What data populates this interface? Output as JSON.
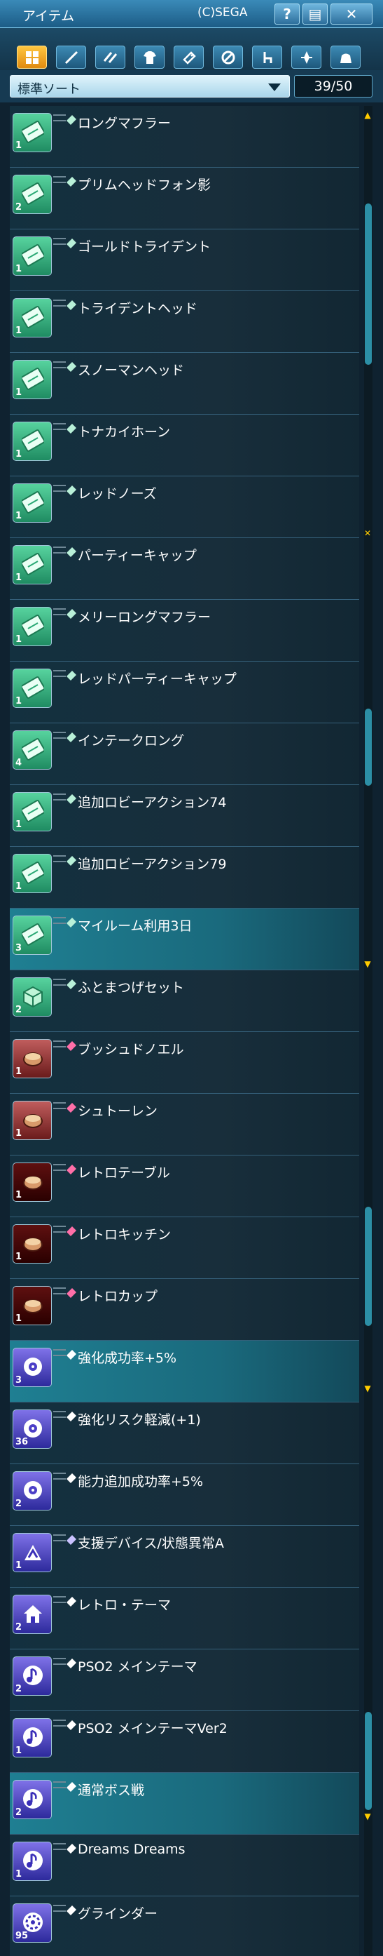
{
  "window": {
    "title": "アイテム",
    "copyright": "(C)SEGA"
  },
  "title_buttons": [
    {
      "name": "help-button",
      "label": "?"
    },
    {
      "name": "layout-button",
      "label": "▤"
    },
    {
      "name": "close-button",
      "label": "✕"
    }
  ],
  "categories": [
    {
      "name": "all-category-tab",
      "active": true
    },
    {
      "name": "weapon-category-tab"
    },
    {
      "name": "double-weapon-category-tab"
    },
    {
      "name": "armor-category-tab"
    },
    {
      "name": "accessory-category-tab"
    },
    {
      "name": "unit-category-tab"
    },
    {
      "name": "furniture-category-tab"
    },
    {
      "name": "compass-category-tab"
    },
    {
      "name": "bag-category-tab"
    }
  ],
  "sort": {
    "label": "標準ソート"
  },
  "capacity": "39/50",
  "items": [
    {
      "name": "ロングマフラー",
      "qty": "1",
      "icon": "ticket",
      "color": "green"
    },
    {
      "name": "プリムヘッドフォン影",
      "qty": "2",
      "icon": "ticket",
      "color": "green"
    },
    {
      "name": "ゴールドトライデント",
      "qty": "1",
      "icon": "ticket",
      "color": "green"
    },
    {
      "name": "トライデントヘッド",
      "qty": "1",
      "icon": "ticket",
      "color": "green"
    },
    {
      "name": "スノーマンヘッド",
      "qty": "1",
      "icon": "ticket",
      "color": "green"
    },
    {
      "name": "トナカイホーン",
      "qty": "1",
      "icon": "ticket",
      "color": "green"
    },
    {
      "name": "レッドノーズ",
      "qty": "1",
      "icon": "ticket",
      "color": "green"
    },
    {
      "name": "パーティーキャップ",
      "qty": "1",
      "icon": "ticket",
      "color": "green"
    },
    {
      "name": "メリーロングマフラー",
      "qty": "1",
      "icon": "ticket",
      "color": "green"
    },
    {
      "name": "レッドパーティーキャップ",
      "qty": "1",
      "icon": "ticket",
      "color": "green"
    },
    {
      "name": "インテークロング",
      "qty": "4",
      "icon": "ticket",
      "color": "green"
    },
    {
      "name": "追加ロビーアクション74",
      "qty": "1",
      "icon": "ticket",
      "color": "green"
    },
    {
      "name": "追加ロビーアクション79",
      "qty": "1",
      "icon": "ticket",
      "color": "green"
    },
    {
      "name": "マイルーム利用3日",
      "qty": "3",
      "icon": "ticket",
      "color": "green",
      "highlight": true
    },
    {
      "name": "ふとまつげセット",
      "qty": "2",
      "icon": "box",
      "color": "green"
    },
    {
      "name": "ブッシュドノエル",
      "qty": "1",
      "icon": "furniture",
      "color": "red"
    },
    {
      "name": "シュトーレン",
      "qty": "1",
      "icon": "furniture",
      "color": "red"
    },
    {
      "name": "レトロテーブル",
      "qty": "1",
      "icon": "furniture",
      "color": "darkred"
    },
    {
      "name": "レトロキッチン",
      "qty": "1",
      "icon": "furniture",
      "color": "darkred"
    },
    {
      "name": "レトロカップ",
      "qty": "1",
      "icon": "furniture",
      "color": "darkred"
    },
    {
      "name": "強化成功率+5%",
      "qty": "3",
      "icon": "disc",
      "color": "purple",
      "highlight": true
    },
    {
      "name": "強化リスク軽減(+1)",
      "qty": "36",
      "icon": "disc",
      "color": "purple"
    },
    {
      "name": "能力追加成功率+5%",
      "qty": "2",
      "icon": "disc",
      "color": "purple"
    },
    {
      "name": "支援デバイス/状態異常A",
      "qty": "1",
      "icon": "device",
      "color": "purple"
    },
    {
      "name": "レトロ・テーマ",
      "qty": "2",
      "icon": "home",
      "color": "purple"
    },
    {
      "name": "PSO2 メインテーマ",
      "qty": "2",
      "icon": "music",
      "color": "purple"
    },
    {
      "name": "PSO2 メインテーマVer2",
      "qty": "1",
      "icon": "music",
      "color": "purple"
    },
    {
      "name": "通常ボス戦",
      "qty": "2",
      "icon": "music",
      "color": "purple",
      "highlight": true
    },
    {
      "name": "Dreams Dreams",
      "qty": "1",
      "icon": "music",
      "color": "purple"
    },
    {
      "name": "グラインダー",
      "qty": "95",
      "icon": "grinder",
      "color": "purple"
    }
  ],
  "colors": {
    "accent": "#2c8fa6",
    "highlight_row": "#1f7f92",
    "active_tab": "#f0a020"
  }
}
